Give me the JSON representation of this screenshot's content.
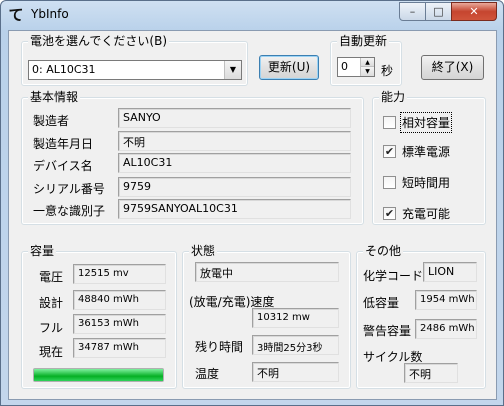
{
  "window": {
    "title": "YbInfo",
    "app_icon_glyph": "て",
    "buttons": {
      "minimize": "–",
      "maximize": "□",
      "close": "✕"
    }
  },
  "battery_select": {
    "label": "電池を選んでください(B)",
    "value": "0: AL10C31",
    "arrow": "▼"
  },
  "refresh_button": {
    "label": "更新(U)"
  },
  "auto_update": {
    "label": "自動更新",
    "value": "0",
    "unit": "秒",
    "up": "▲",
    "down": "▼"
  },
  "exit_button": {
    "label": "終了(X)"
  },
  "basic_info": {
    "label": "基本情報",
    "rows": [
      {
        "label": "製造者",
        "value": "SANYO"
      },
      {
        "label": "製造年月日",
        "value": "不明"
      },
      {
        "label": "デバイス名",
        "value": "AL10C31"
      },
      {
        "label": "シリアル番号",
        "value": "9759"
      },
      {
        "label": "一意な識別子",
        "value": "9759SANYOAL10C31"
      }
    ]
  },
  "capability": {
    "label": "能力",
    "checkmark": "✔",
    "items": [
      {
        "label": "相対容量",
        "checked": false
      },
      {
        "label": "標準電源",
        "checked": true
      },
      {
        "label": "短時間用",
        "checked": false
      },
      {
        "label": "充電可能",
        "checked": true
      }
    ]
  },
  "capacity": {
    "label": "容量",
    "rows": [
      {
        "label": "電圧",
        "value": "12515 mv"
      },
      {
        "label": "設計",
        "value": "48840 mWh"
      },
      {
        "label": "フル",
        "value": "36153 mWh"
      },
      {
        "label": "現在",
        "value": "34787 mWh"
      }
    ],
    "progress_fraction": 1.0
  },
  "state": {
    "label": "状態",
    "status": "放電中",
    "rate_label": "(放電/充電)速度",
    "rate": "10312 mw",
    "remaining_label": "残り時間",
    "remaining": "3時間25分3秒",
    "temperature_label": "温度",
    "temperature": "不明"
  },
  "other": {
    "label": "その他",
    "chemistry_label": "化学コード",
    "chemistry": "LION",
    "low_label": "低容量",
    "low": "1954 mWh",
    "warning_label": "警告容量",
    "warning": "2486 mWh",
    "cycle_label": "サイクル数",
    "cycle": "不明"
  },
  "colors": {
    "progress": "#06b025",
    "close_button": "#c6452f"
  }
}
